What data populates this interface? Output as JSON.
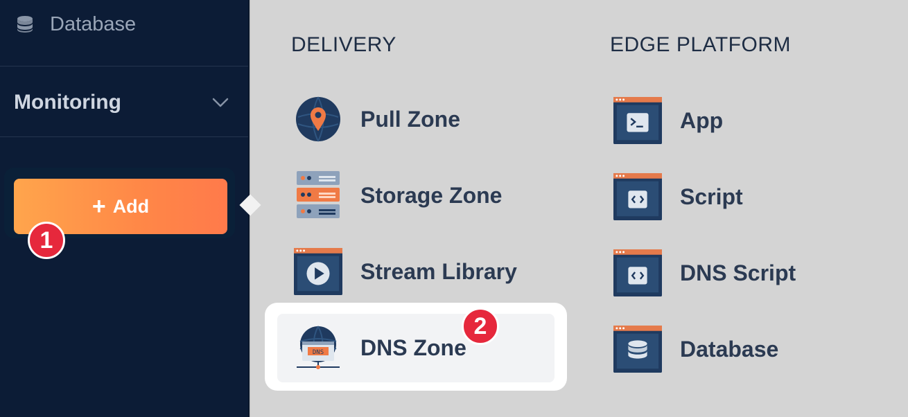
{
  "sidebar": {
    "database_label": "Database",
    "monitoring_label": "Monitoring",
    "add_label": "Add",
    "add_plus": "+"
  },
  "steps": {
    "one": "1",
    "two": "2"
  },
  "delivery": {
    "heading": "DELIVERY",
    "items": [
      {
        "label": "Pull Zone",
        "icon": "map-pin-globe-icon"
      },
      {
        "label": "Storage Zone",
        "icon": "server-stack-icon"
      },
      {
        "label": "Stream Library",
        "icon": "video-play-icon"
      },
      {
        "label": "DNS Zone",
        "icon": "dns-globe-icon"
      }
    ]
  },
  "edge_platform": {
    "heading": "EDGE PLATFORM",
    "items": [
      {
        "label": "App",
        "icon": "terminal-window-icon"
      },
      {
        "label": "Script",
        "icon": "code-window-icon"
      },
      {
        "label": "DNS Script",
        "icon": "code-window-icon"
      },
      {
        "label": "Database",
        "icon": "database-window-icon"
      }
    ]
  },
  "dns_badge_text": "DNS",
  "colors": {
    "sidebar_bg": "#0c1c36",
    "accent_orange": "#ff8747",
    "badge_red": "#e6283c",
    "icon_navy": "#1f3a5f"
  }
}
